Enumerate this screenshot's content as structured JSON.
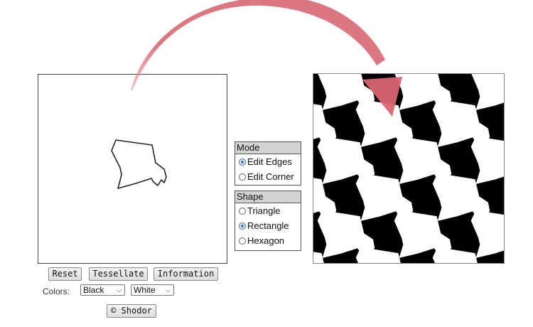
{
  "controls": {
    "reset_label": "Reset",
    "tessellate_label": "Tessellate",
    "information_label": "Information",
    "colors_label": "Colors:",
    "color1_value": "Black",
    "color2_value": "White",
    "shodor_label": "© Shodor"
  },
  "mode_panel": {
    "title": "Mode",
    "options": [
      {
        "label": "Edit Edges",
        "selected": true
      },
      {
        "label": "Edit Corner",
        "selected": false
      }
    ]
  },
  "shape_panel": {
    "title": "Shape",
    "options": [
      {
        "label": "Triangle",
        "selected": false
      },
      {
        "label": "Rectangle",
        "selected": true
      },
      {
        "label": "Hexagon",
        "selected": false
      }
    ]
  },
  "colors": {
    "tile_primary": "#000000",
    "tile_secondary": "#ffffff",
    "arrow": "#d9707a",
    "radio_selected": "#2f6fd6"
  }
}
